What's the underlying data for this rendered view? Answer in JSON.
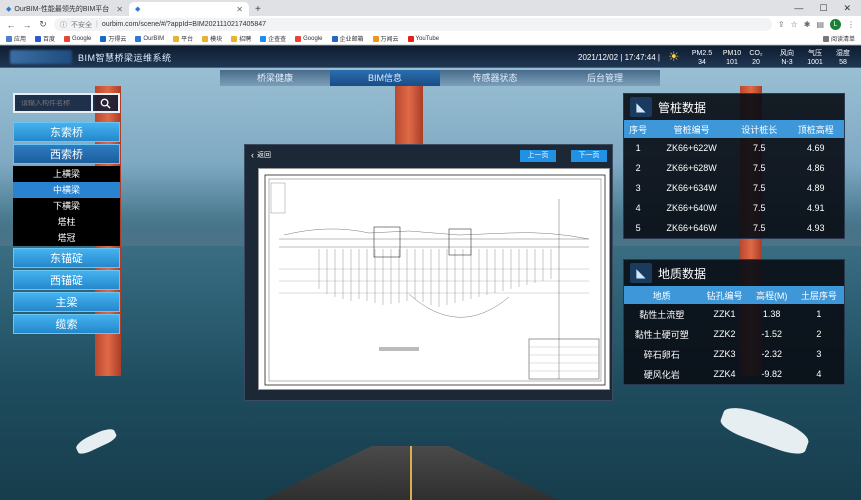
{
  "browser": {
    "tabs": [
      {
        "title": "OurBIM-性能最领先的BIM平台",
        "active": false
      },
      {
        "title": "",
        "active": true
      }
    ],
    "address": {
      "security": "不安全",
      "url": "ourbim.com/scene/#/?appId=BIM20211102174058​47"
    },
    "profile_initial": "L",
    "bookmarks": [
      "应用",
      "百度",
      "Google",
      "万得云",
      "OurBIM",
      "平台",
      "模块",
      "招聘",
      "企查查",
      "Google",
      "企业邮箱",
      "万闻云",
      "YouTube"
    ],
    "reading_list": "阅读清单"
  },
  "app": {
    "system_title": "BIM智慧桥梁运维系统",
    "datetime": "2021/12/02 | 17:47:44 |",
    "metrics": [
      {
        "label": "PM2.5",
        "value": "34"
      },
      {
        "label": "PM10",
        "value": "101"
      },
      {
        "label": "CO₂",
        "value": "20"
      },
      {
        "label": "风向",
        "value": "N-3"
      },
      {
        "label": "气压",
        "value": "1001"
      },
      {
        "label": "湿度",
        "value": "58"
      }
    ],
    "nav": [
      {
        "label": "桥梁健康",
        "active": false
      },
      {
        "label": "BIM信息",
        "active": true
      },
      {
        "label": "传感器状态",
        "active": false
      },
      {
        "label": "后台管理",
        "active": false
      }
    ]
  },
  "search": {
    "placeholder": "请输入构件名称"
  },
  "tree": {
    "groups": [
      {
        "label": "东索桥",
        "selected": false
      },
      {
        "label": "西索桥",
        "selected": true,
        "children": [
          {
            "label": "上横梁",
            "selected": false
          },
          {
            "label": "中横梁",
            "selected": true
          },
          {
            "label": "下横梁",
            "selected": false
          },
          {
            "label": "塔柱",
            "selected": false
          },
          {
            "label": "塔冠",
            "selected": false
          }
        ]
      },
      {
        "label": "东锚碇",
        "selected": false
      },
      {
        "label": "西锚碇",
        "selected": false
      },
      {
        "label": "主梁",
        "selected": false
      },
      {
        "label": "缆索",
        "selected": false
      }
    ]
  },
  "viewer": {
    "back": "返回",
    "prev": "上一页",
    "next": "下一页"
  },
  "pile_panel": {
    "title": "管桩数据",
    "headers": [
      "序号",
      "管桩编号",
      "设计桩长",
      "顶桩高程"
    ],
    "rows": [
      [
        "1",
        "ZK66+622W",
        "7.5",
        "4.69"
      ],
      [
        "2",
        "ZK66+628W",
        "7.5",
        "4.86"
      ],
      [
        "3",
        "ZK66+634W",
        "7.5",
        "4.89"
      ],
      [
        "4",
        "ZK66+640W",
        "7.5",
        "4.91"
      ],
      [
        "5",
        "ZK66+646W",
        "7.5",
        "4.93"
      ]
    ]
  },
  "geo_panel": {
    "title": "地质数据",
    "headers": [
      "地质",
      "钻孔编号",
      "高程(M)",
      "土层序号"
    ],
    "rows": [
      [
        "黏性土流塑",
        "ZZK1",
        "1.38",
        "1"
      ],
      [
        "黏性土硬可塑",
        "ZZK2",
        "-1.52",
        "2"
      ],
      [
        "碎石卵石",
        "ZZK3",
        "-2.32",
        "3"
      ],
      [
        "硬风化岩",
        "ZZK4",
        "-9.82",
        "4"
      ]
    ]
  }
}
